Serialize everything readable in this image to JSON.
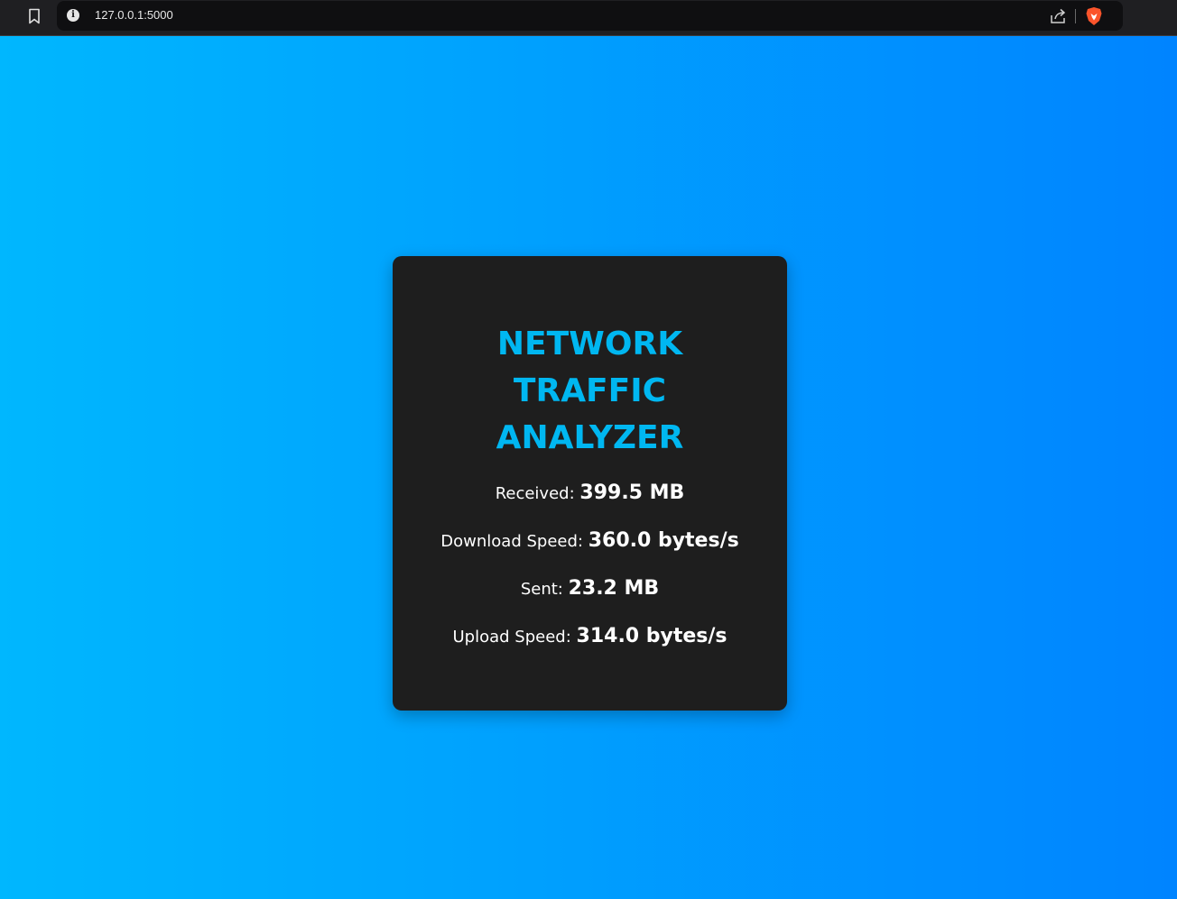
{
  "browser": {
    "url": "127.0.0.1:5000",
    "icons": [
      "bookmark-icon",
      "info-icon",
      "share-icon",
      "brave-shield-icon"
    ]
  },
  "colors": {
    "background_gradient_start": "#00b7fe",
    "background_gradient_end": "#0084ff",
    "card_background": "#1e1e1e",
    "title_color": "#00b7f1",
    "text_color": "#ffffff"
  },
  "card": {
    "title_lines": [
      "NETWORK",
      "TRAFFIC",
      "ANALYZER"
    ],
    "stats": [
      {
        "label": "Received:",
        "value": "399.5 MB"
      },
      {
        "label": "Download Speed:",
        "value": "360.0 bytes/s"
      },
      {
        "label": "Sent:",
        "value": "23.2 MB"
      },
      {
        "label": "Upload Speed:",
        "value": "314.0 bytes/s"
      }
    ]
  }
}
